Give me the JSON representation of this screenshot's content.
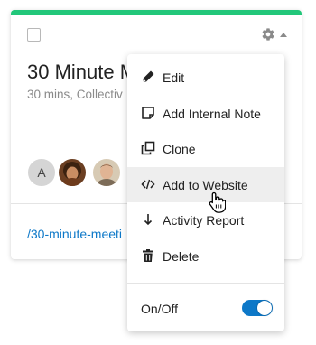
{
  "card": {
    "accent_color": "#22c77a",
    "title": "30 Minute M",
    "subtitle": "30 mins, Collectiv",
    "avatar_initial": "A",
    "link": "/30-minute-meeti"
  },
  "menu": {
    "items": [
      {
        "label": "Edit",
        "icon": "pencil-icon"
      },
      {
        "label": "Add Internal Note",
        "icon": "note-icon"
      },
      {
        "label": "Clone",
        "icon": "clone-icon"
      },
      {
        "label": "Add to Website",
        "icon": "code-icon",
        "hovered": true
      },
      {
        "label": "Activity Report",
        "icon": "arrow-down-icon"
      },
      {
        "label": "Delete",
        "icon": "trash-icon"
      }
    ],
    "toggle": {
      "label": "On/Off",
      "on": true,
      "color": "#0d78c8"
    }
  }
}
